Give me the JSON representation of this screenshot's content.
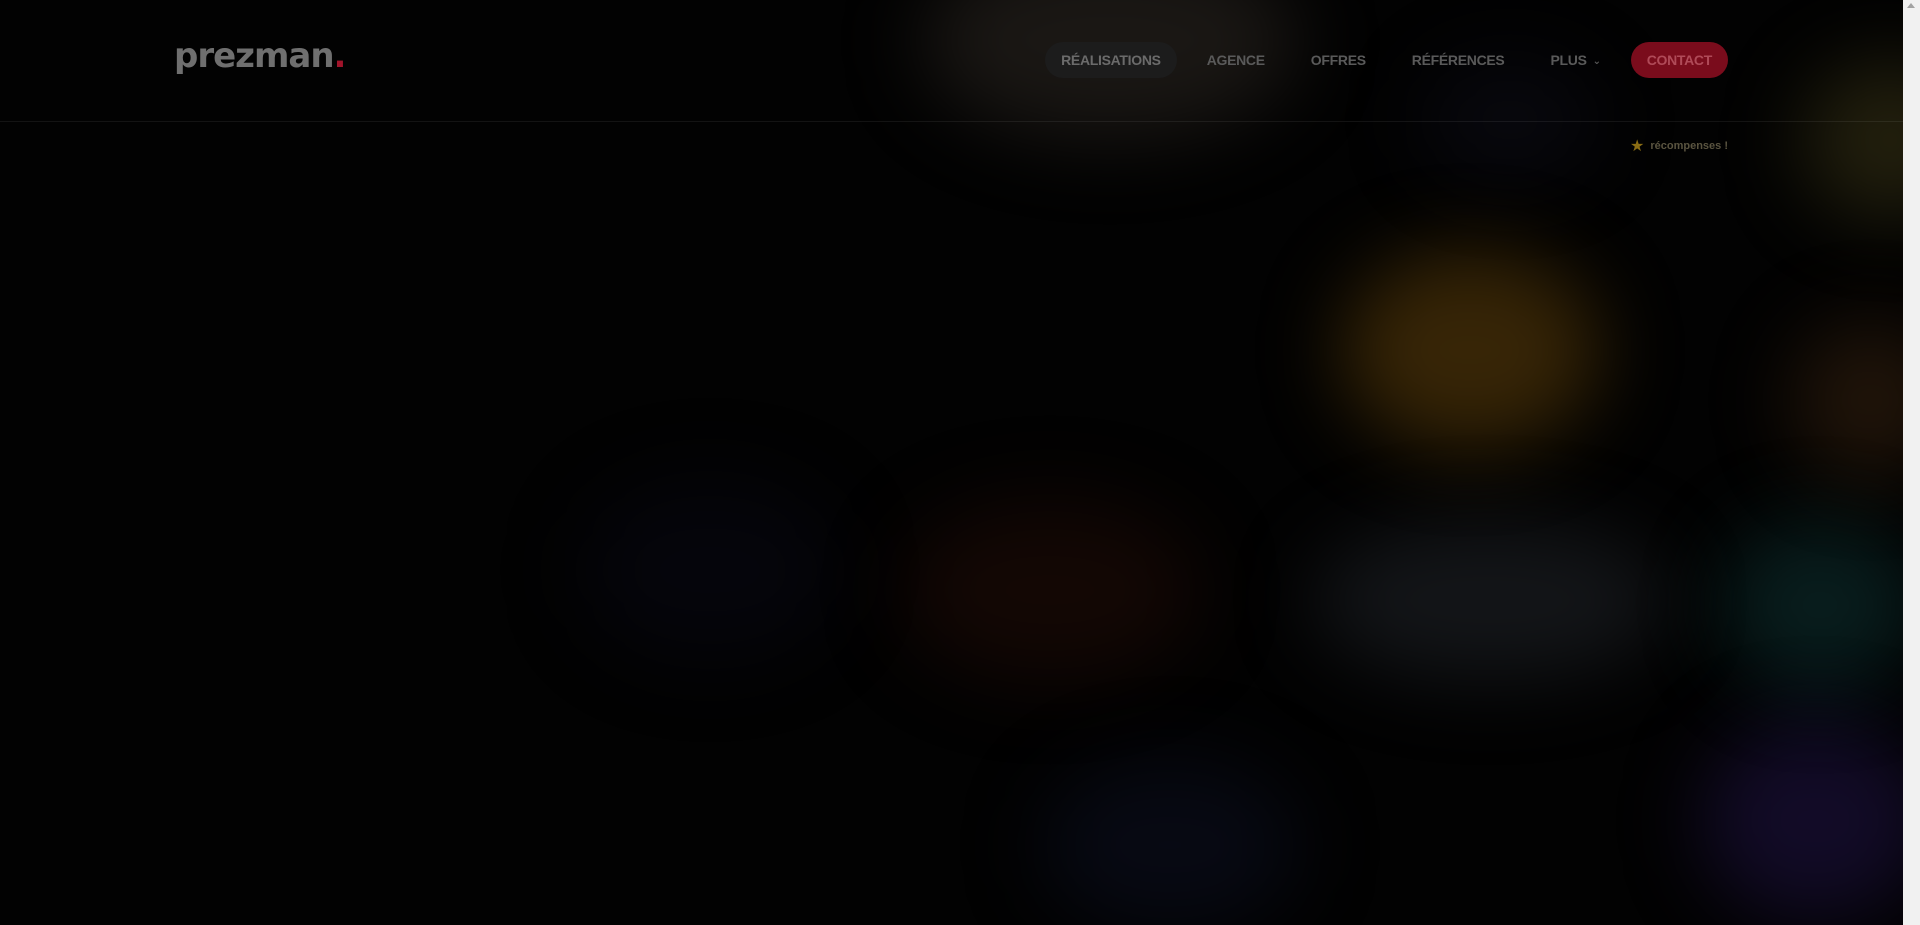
{
  "brand": {
    "name": "prezman",
    "dot": ".",
    "accent_color": "#a0142a"
  },
  "nav": {
    "items": [
      {
        "label": "RÉALISATIONS",
        "active": true
      },
      {
        "label": "AGENCE"
      },
      {
        "label": "OFFRES"
      },
      {
        "label": "RÉFÉRENCES"
      },
      {
        "label": "PLUS",
        "icon": "chevron-down-icon"
      }
    ],
    "contact_label": "CONTACT",
    "contact_color": "#7a0c1c"
  },
  "awards": {
    "icon": "star-icon",
    "label": "récompenses !"
  }
}
